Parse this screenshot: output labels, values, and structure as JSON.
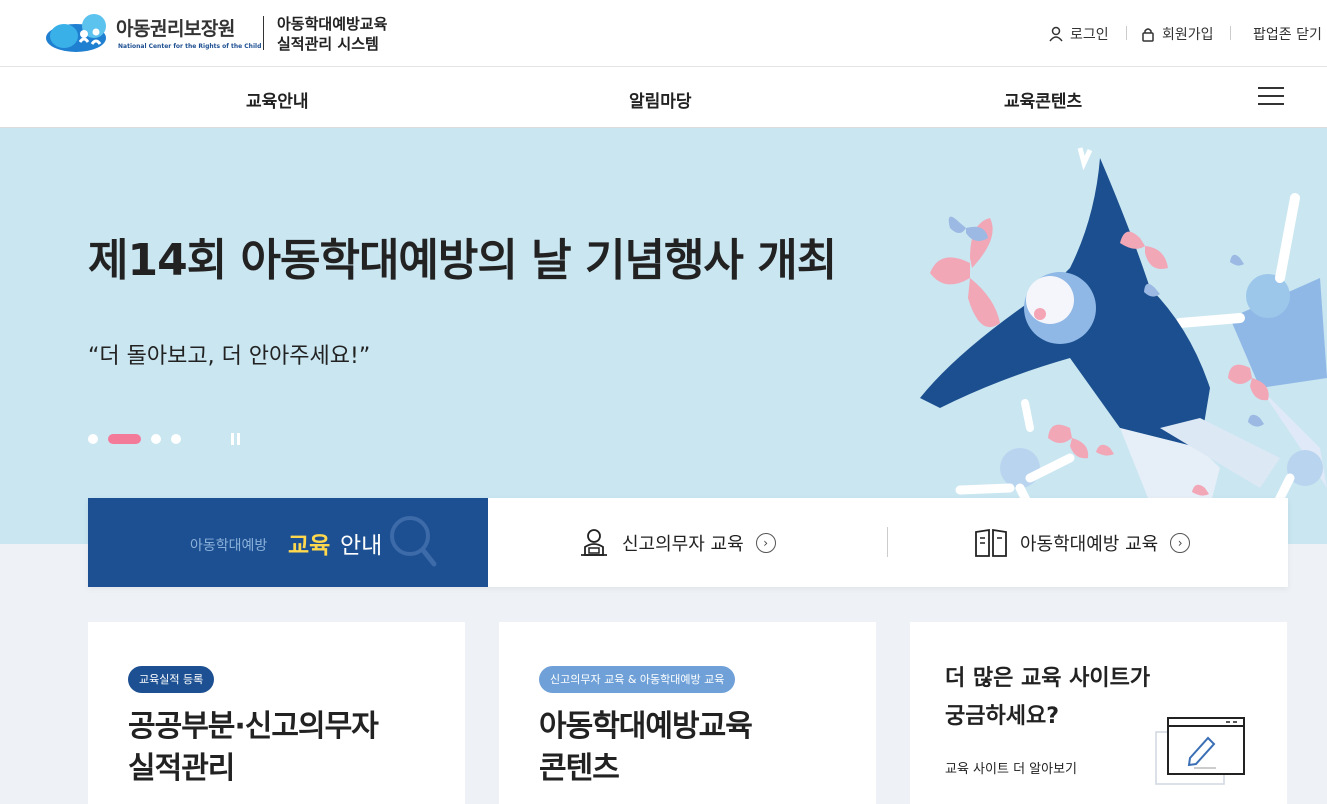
{
  "header": {
    "logo_name": "아동권리보장원",
    "logo_en": "National Center for the Rights of the Child",
    "system_title_line1": "아동학대예방교육",
    "system_title_line2": "실적관리 시스템",
    "login": "로그인",
    "join": "회원가입",
    "popup_close": "팝업존 닫기"
  },
  "gnb": {
    "items": [
      "교육안내",
      "알림마당",
      "교육콘텐츠"
    ]
  },
  "hero": {
    "title": "제14회 아동학대예방의 날 기념행사 개최",
    "subtitle": "“더 돌아보고, 더 안아주세요!”",
    "slide_count": 4,
    "active_slide": 2
  },
  "quick": {
    "pre": "아동학대예방",
    "edu": "교육",
    "info": "안내",
    "link1": "신고의무자 교육",
    "link2": "아동학대예방 교육"
  },
  "cards": {
    "card1": {
      "badge": "교육실적 등록",
      "title_line1": "공공부분·신고의무자",
      "title_line2": "실적관리"
    },
    "card2": {
      "badge": "신고의무자 교육 & 아동학대예방 교육",
      "title_line1": "아동학대예방교육",
      "title_line2": "콘텐츠"
    },
    "card3": {
      "title_line1": "더 많은 교육 사이트가",
      "title_line2": "궁금하세요?",
      "link": "교육 사이트 더 알아보기"
    }
  },
  "colors": {
    "brand_navy": "#1d5092",
    "accent_pink": "#f47a9a",
    "hero_bg": "#c9e6f1",
    "highlight_yellow": "#ffd84d"
  }
}
